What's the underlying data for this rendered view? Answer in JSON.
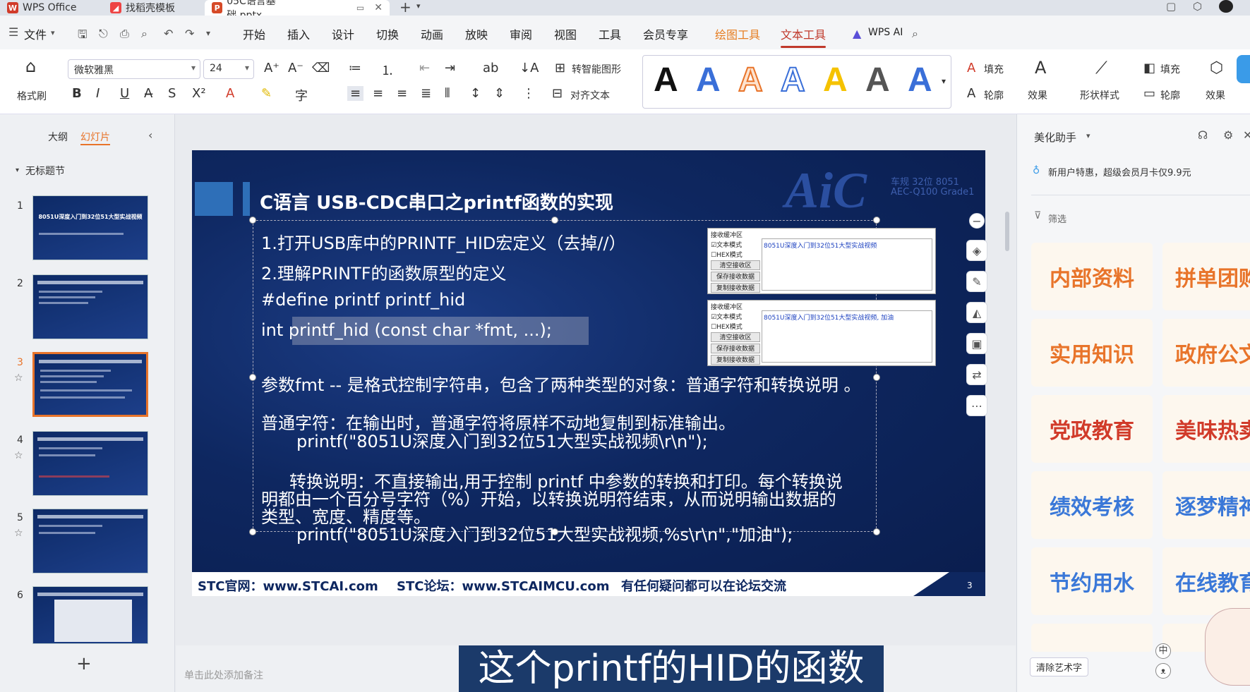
{
  "tabs": [
    {
      "label": "WPS Office",
      "icon": "wps-logo-icon"
    },
    {
      "label": "找稻壳模板",
      "icon": "docer-logo-icon"
    },
    {
      "label": "05C语言基础.pptx",
      "icon": "pptx-file-icon"
    }
  ],
  "menubar": {
    "file": "文件",
    "items": [
      "开始",
      "插入",
      "设计",
      "切换",
      "动画",
      "放映",
      "审阅",
      "视图",
      "工具",
      "会员专享"
    ],
    "drawing_tools": "绘图工具",
    "text_tools": "文本工具",
    "wps_ai": "WPS AI"
  },
  "ribbon": {
    "format_painter": "格式刷",
    "font_name": "微软雅黑",
    "font_size": "24",
    "smart_shape": "转智能图形",
    "align_text": "对齐文本",
    "fill": "填充",
    "outline": "轮廓",
    "effects": "效果",
    "shape_style": "形状样式",
    "fill2": "填充",
    "outline2": "轮廓",
    "effects2": "效果",
    "wordart_letter": "A",
    "wordart_colors": [
      "#111111",
      "#3a6fd8",
      "#e8742a",
      "#bcd0ee",
      "#f5c200",
      "#555555",
      "#3a6fd8"
    ]
  },
  "leftpane": {
    "tab_outline": "大纲",
    "tab_slides": "幻灯片",
    "section": "无标题节",
    "slides": [
      {
        "num": "1",
        "title": "8051U深度入门到32位51大型实战视频"
      },
      {
        "num": "2",
        "title": ""
      },
      {
        "num": "3",
        "title": ""
      },
      {
        "num": "4",
        "title": ""
      },
      {
        "num": "5",
        "title": ""
      },
      {
        "num": "6",
        "title": ""
      }
    ],
    "add": "+"
  },
  "slide": {
    "title": "C语言 USB-CDC串口之printf函数的实现",
    "logo_text": "AiC",
    "logo_sub1": "车规 32位 8051",
    "logo_sub2": "AEC-Q100 Grade1",
    "lines": [
      "1.打开USB库中的PRINTF_HID宏定义（去掉//）",
      "2.理解PRINTF的函数原型的定义",
      "#define printf  printf_hid",
      "int printf_hid (const char *fmt, ...);"
    ],
    "para1": "参数fmt -- 是格式控制字符串，包含了两种类型的对象：普通字符和转换说明 。",
    "para2": "普通字符：在输出时，普通字符将原样不动地复制到标准输出。",
    "para2_code": "printf(\"8051U深度入门到32位51大型实战视频\\r\\n\");",
    "para3_1": "转换说明：不直接输出,用于控制 printf 中参数的转换和打印。每个转换说",
    "para3_2": "明都由一个百分号字符（%）开始，以转换说明符结束，从而说明输出数据的",
    "para3_3": "类型、宽度、精度等。",
    "para3_code": "printf(\"8051U深度入门到32位51大型实战视频,%s\\r\\n\",\"加油\");",
    "footer_site": "STC官网：www.STCAI.com",
    "footer_forum": "STC论坛：www.STCAIMCU.com",
    "footer_note": "有任何疑问都可以在论坛交流",
    "page_num": "3",
    "inset1": {
      "header": "接收缓冲区",
      "opt1": "☑文本模式",
      "opt2": "☐HEX模式",
      "btn1": "清空接收区",
      "btn2": "保存接收数据",
      "btn3": "复制接收数据",
      "content": "8051U深度入门到32位51大型实战视频"
    },
    "inset2": {
      "header": "接收缓冲区",
      "opt1": "☑文本模式",
      "opt2": "☐HEX模式",
      "btn1": "清空接收区",
      "btn2": "保存接收数据",
      "btn3": "复制接收数据",
      "content": "8051U深度入门到32位51大型实战视频, 加油"
    }
  },
  "notes_placeholder": "单击此处添加备注",
  "caption": "这个printf的HID的函数",
  "rightpane": {
    "title": "美化助手",
    "promo": "新用户特惠，超级会员月卡仅9.9元",
    "filter": "筛选",
    "cards": [
      {
        "label": "内部资料",
        "color": "#e8742a"
      },
      {
        "label": "拼单团购",
        "color": "#e8742a"
      },
      {
        "label": "实用知识",
        "color": "#e8742a"
      },
      {
        "label": "政府公文",
        "color": "#e8742a"
      },
      {
        "label": "党政教育",
        "color": "#d13b2a"
      },
      {
        "label": "美味热卖",
        "color": "#d13b2a"
      },
      {
        "label": "绩效考核",
        "color": "#3a78d8"
      },
      {
        "label": "逐梦精神",
        "color": "#3a78d8"
      },
      {
        "label": "节约用水",
        "color": "#3a78d8"
      },
      {
        "label": "在线教育",
        "color": "#3a78d8"
      }
    ],
    "clear": "清除艺术字"
  }
}
